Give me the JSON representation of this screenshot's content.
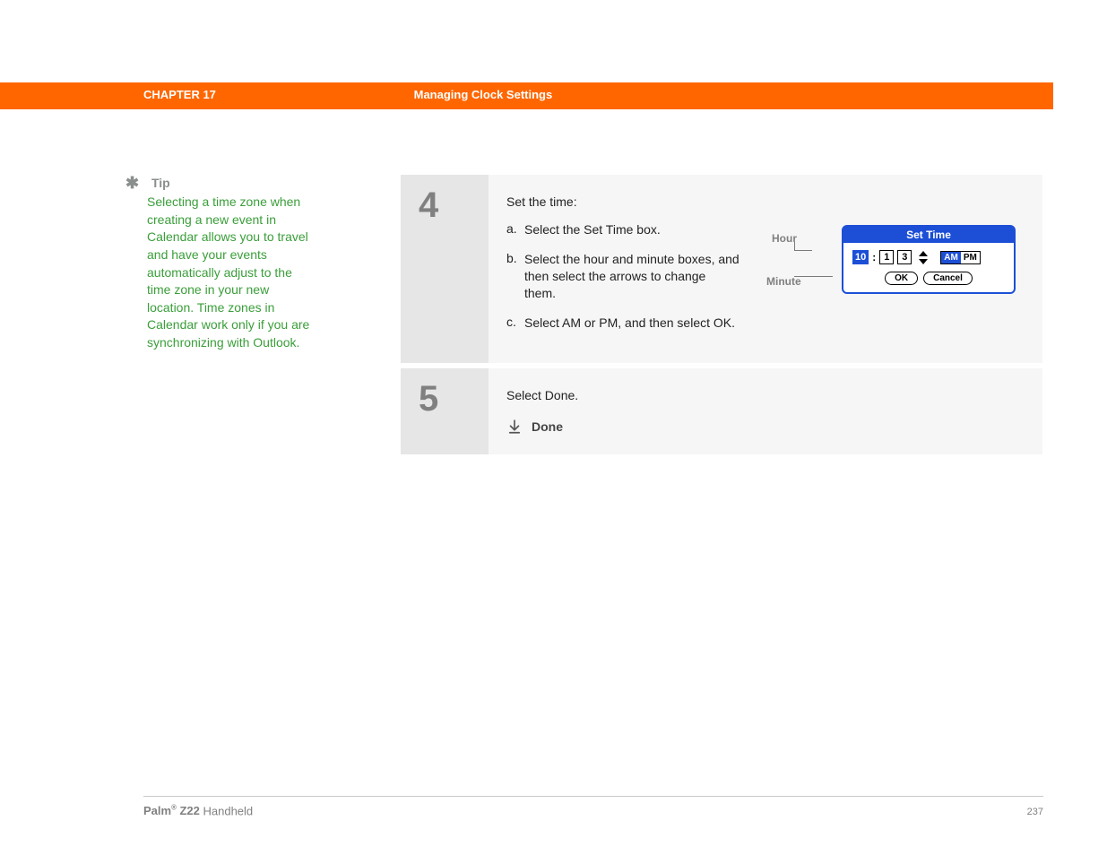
{
  "header": {
    "chapter_label": "CHAPTER 17",
    "chapter_title": "Managing Clock Settings"
  },
  "sidebar": {
    "tip_label": "Tip",
    "tip_body": "Selecting a time zone when creating a new event in Calendar allows you to travel and have your events automatically adjust to the time zone in your new location. Time zones in Calendar work only if you are synchronizing with Outlook."
  },
  "steps": {
    "step4": {
      "number": "4",
      "intro": "Set the time:",
      "items": [
        {
          "marker": "a.",
          "text": "Select the Set Time box."
        },
        {
          "marker": "b.",
          "text": "Select the hour and minute boxes, and then select the arrows to change them."
        },
        {
          "marker": "c.",
          "text": "Select AM or PM, and then select OK."
        }
      ],
      "callouts": {
        "hour": "Hour",
        "minute": "Minute"
      },
      "dialog": {
        "title": "Set Time",
        "hour": "10",
        "min_tens": "1",
        "min_ones": "3",
        "am": "AM",
        "pm": "PM",
        "ok": "OK",
        "cancel": "Cancel"
      }
    },
    "step5": {
      "number": "5",
      "text": "Select Done.",
      "done_label": "Done"
    }
  },
  "footer": {
    "brand": "Palm",
    "reg": "®",
    "model": "Z22",
    "product": "Handheld",
    "page": "237"
  }
}
